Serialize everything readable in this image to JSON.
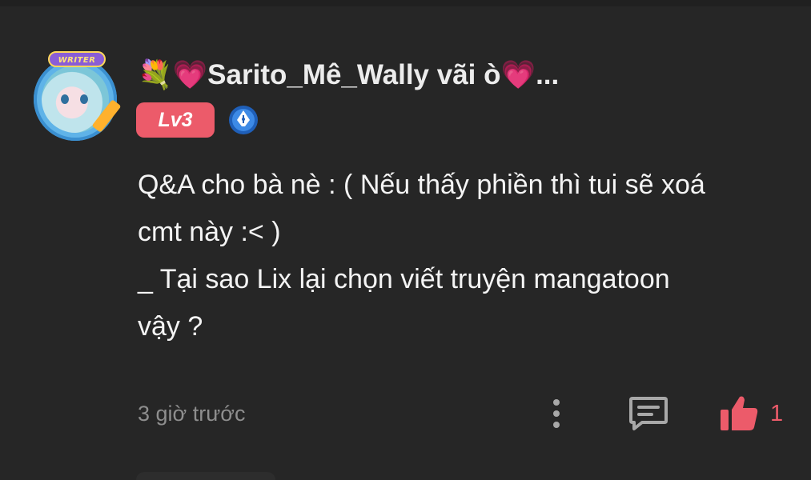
{
  "comment": {
    "avatar": {
      "badge_label": "WRITER"
    },
    "username": "💐💗Sarito_Mê_Wally vãi ò💗...",
    "level_badge": "Lv3",
    "writer_badge_icon": "pen-nib-icon",
    "content_lines": [
      "Q&A cho bà nè : ( Nếu thấy phiền thì tui sẽ xoá",
      "cmt này :< )",
      "_ Tại sao Lix  lại chọn viết truyện mangatoon",
      "vậy ?"
    ],
    "timestamp": "3 giờ trước",
    "actions": {
      "more_icon": "more-vertical-icon",
      "reply_icon": "comment-icon",
      "like_icon": "thumbs-up-icon",
      "like_count": "1"
    }
  },
  "colors": {
    "background": "#262626",
    "accent": "#ec5b6a",
    "secondary_text": "#8e8e8e",
    "icon_gray": "#a8a8a8"
  }
}
